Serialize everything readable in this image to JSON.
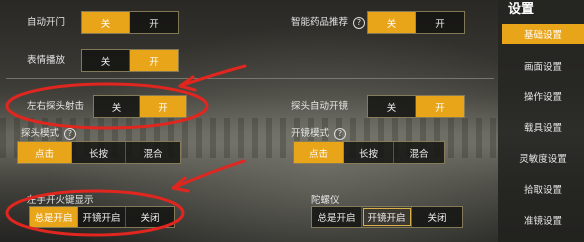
{
  "sidebar": {
    "title": "设置",
    "items": [
      {
        "label": "基础设置",
        "active": true
      },
      {
        "label": "画面设置",
        "active": false
      },
      {
        "label": "操作设置",
        "active": false
      },
      {
        "label": "载具设置",
        "active": false
      },
      {
        "label": "灵敏度设置",
        "active": false
      },
      {
        "label": "拾取设置",
        "active": false
      },
      {
        "label": "准镜设置",
        "active": false
      }
    ]
  },
  "settings": {
    "auto_door": {
      "label": "自动开门",
      "options": [
        "关",
        "开"
      ],
      "selected": "关"
    },
    "smart_medicine": {
      "label": "智能药品推荐",
      "help": "?",
      "options": [
        "关",
        "开"
      ],
      "selected": "关"
    },
    "emote": {
      "label": "表情播放",
      "options": [
        "关",
        "开"
      ],
      "selected": "开"
    },
    "peek_fire": {
      "label": "左右探头射击",
      "options": [
        "关",
        "开"
      ],
      "selected": "开"
    },
    "peek_auto_scope": {
      "label": "探头自动开镜",
      "options": [
        "关",
        "开"
      ],
      "selected": "开"
    },
    "peek_mode": {
      "label": "探头模式",
      "help": "?",
      "options": [
        "点击",
        "长按",
        "混合"
      ],
      "selected": "点击"
    },
    "scope_mode": {
      "label": "开镜模式",
      "help": "?",
      "options": [
        "点击",
        "长按",
        "混合"
      ],
      "selected": "点击"
    },
    "left_fire": {
      "label": "左手开火键显示",
      "options": [
        "总是开启",
        "开镜开启",
        "关闭"
      ],
      "selected": "总是开启"
    },
    "gyroscope": {
      "label": "陀螺仪",
      "options": [
        "总是开启",
        "开镜开启",
        "关闭"
      ],
      "selected": "开镜开启"
    }
  },
  "colors": {
    "accent": "#e9a51a",
    "annotation": "#e0261e"
  }
}
